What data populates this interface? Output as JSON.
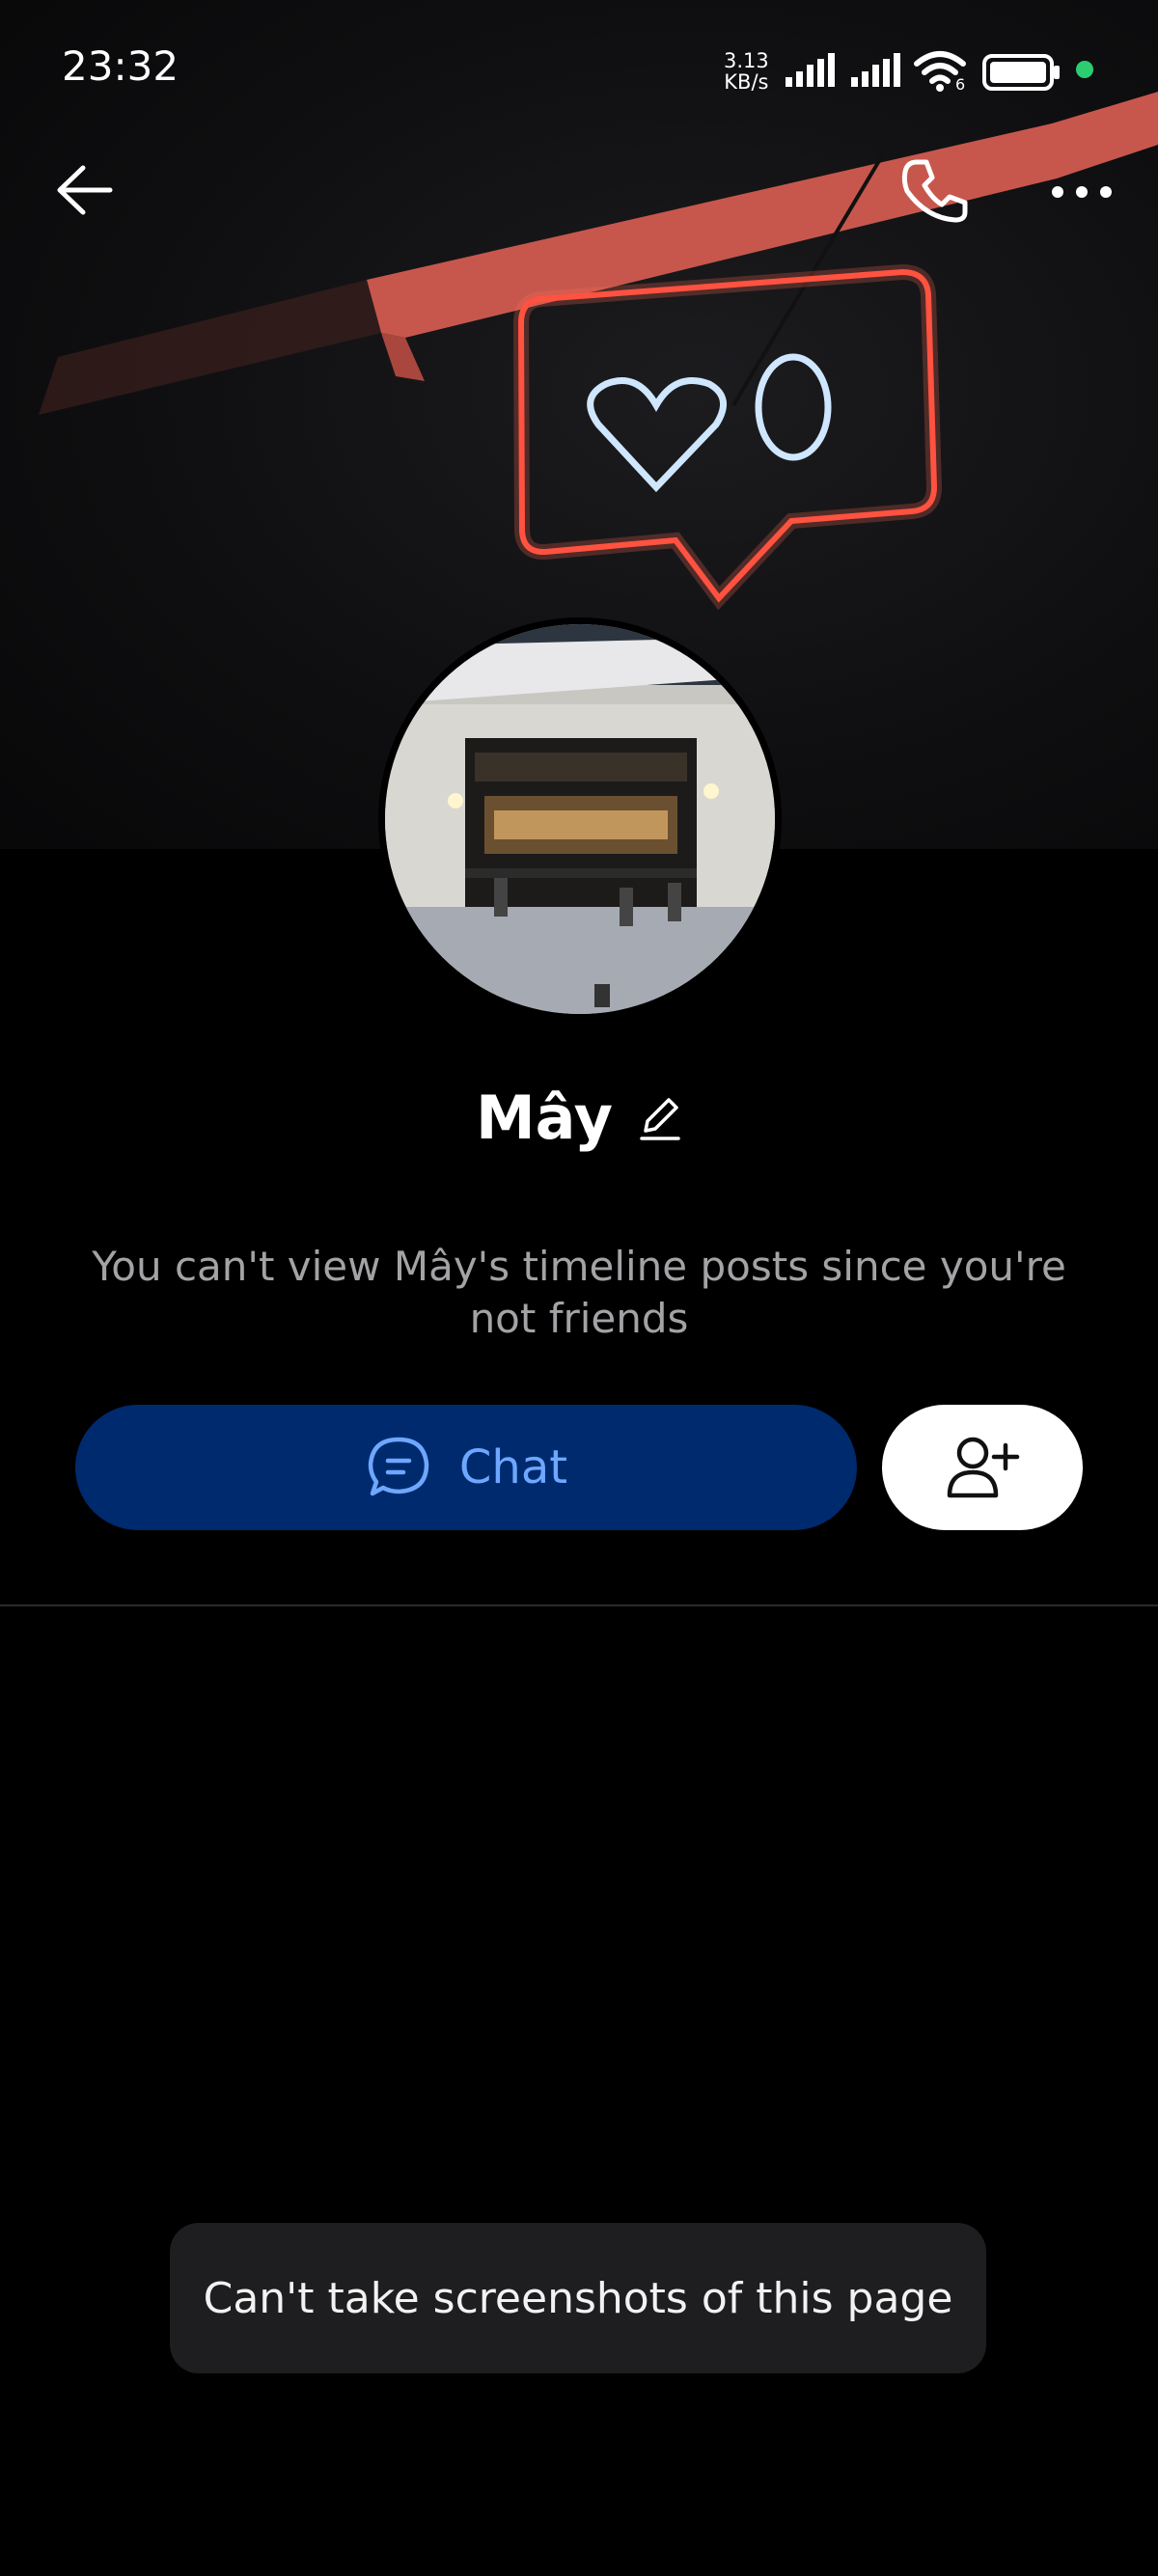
{
  "status_bar": {
    "time": "23:32",
    "net_speed_value": "3.13",
    "net_speed_unit": "KB/s",
    "wifi_badge": "6",
    "icons": [
      "cellular-signal-icon",
      "cellular-signal-icon",
      "wifi-icon",
      "battery-icon",
      "active-dot"
    ],
    "active_dot_color": "#2ecc71"
  },
  "nav": {
    "back_icon": "arrow-left-icon",
    "call_icon": "phone-icon",
    "more_icon": "more-horizontal-icon"
  },
  "profile": {
    "name": "Mây",
    "edit_icon": "pencil-icon",
    "timeline_notice": "You can't view Mây's timeline posts since you're not friends"
  },
  "actions": {
    "chat_label": "Chat",
    "chat_icon": "chat-bubble-icon",
    "add_friend_icon": "add-user-icon",
    "chat_bg": "#002a6e",
    "chat_fg": "#6ea7ff"
  },
  "toast": {
    "text": "Can't take screenshots of this page"
  }
}
